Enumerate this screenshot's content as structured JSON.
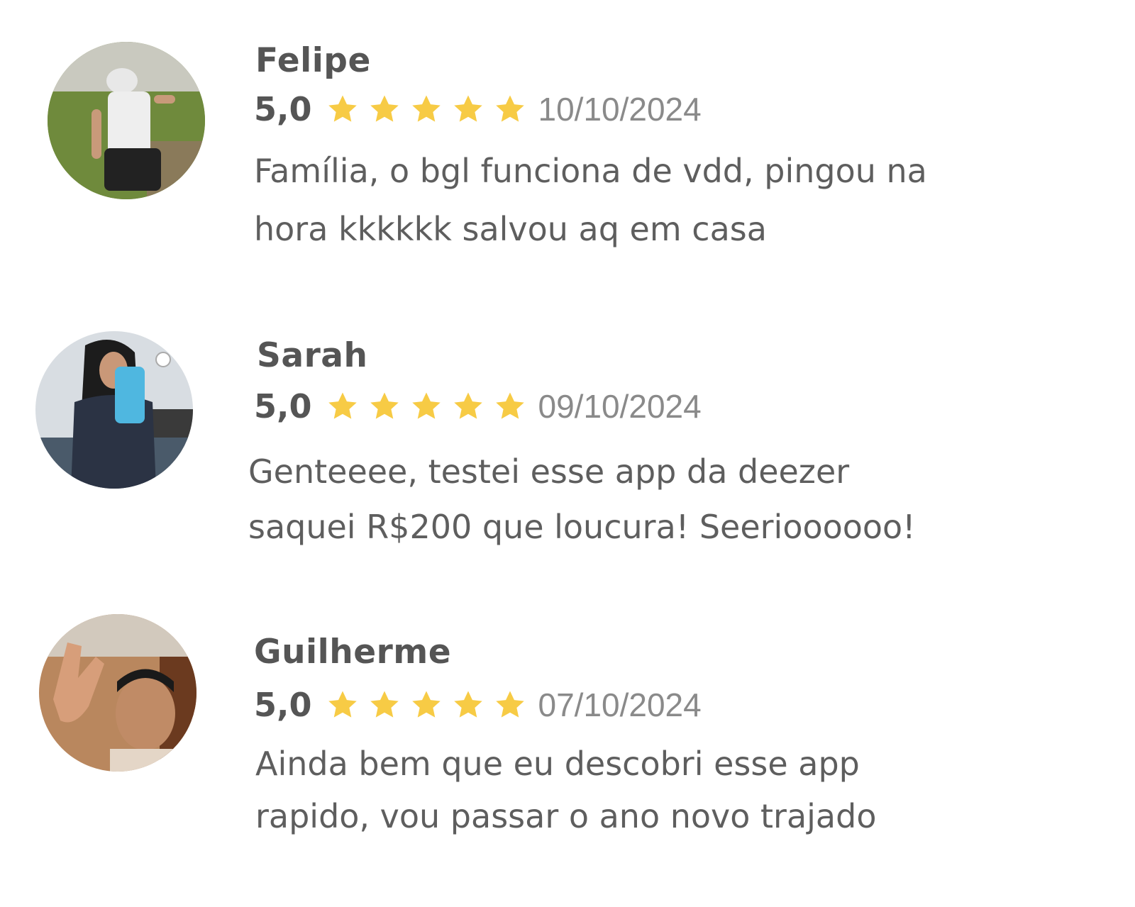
{
  "colors": {
    "star": "#f7cb45",
    "name": "#555555",
    "date": "#8a8a8a",
    "text": "#5e5e5e"
  },
  "reviews": [
    {
      "name": "Felipe",
      "score": "5,0",
      "stars": 5,
      "date": "10/10/2024",
      "lines": [
        "Família, o bgl funciona de vdd, pingou na",
        "hora kkkkkk salvou aq em casa"
      ]
    },
    {
      "name": "Sarah",
      "score": "5,0",
      "stars": 5,
      "date": "09/10/2024",
      "lines": [
        "Genteeee, testei esse app da deezer",
        "saquei R$200 que loucura! Seerioooooo!"
      ]
    },
    {
      "name": "Guilherme",
      "score": "5,0",
      "stars": 5,
      "date": "07/10/2024",
      "lines": [
        "Ainda bem que eu descobri esse app",
        "rapido, vou passar o ano novo trajado"
      ]
    }
  ]
}
